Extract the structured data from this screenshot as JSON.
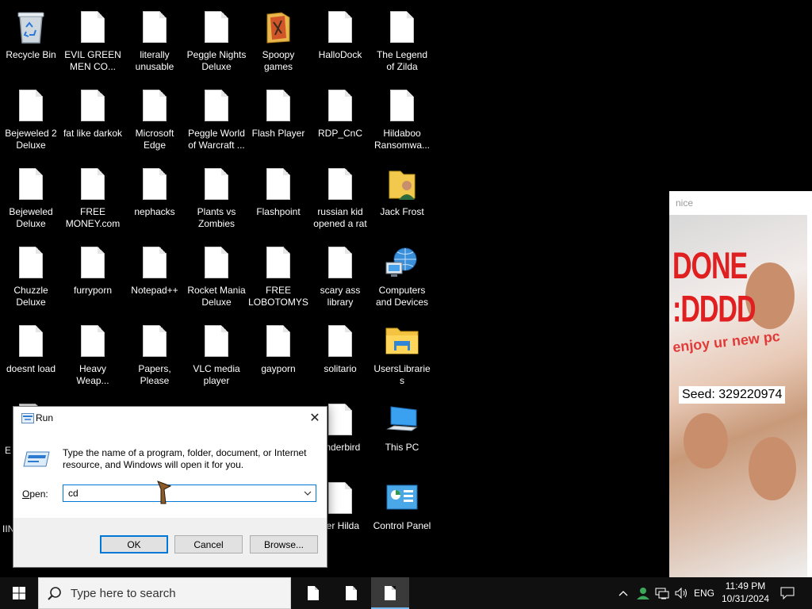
{
  "desktop_icons": [
    {
      "label": "Recycle Bin",
      "icon": "recycle-bin-icon"
    },
    {
      "label": "EVIL GREEN MEN CO...",
      "icon": "document-icon"
    },
    {
      "label": "literally unusable",
      "icon": "document-icon"
    },
    {
      "label": "Peggle Nights Deluxe",
      "icon": "document-icon"
    },
    {
      "label": "Spoopy games",
      "icon": "folder-icon"
    },
    {
      "label": "HalloDock",
      "icon": "document-icon"
    },
    {
      "label": "The Legend of Zilda",
      "icon": "document-icon"
    },
    {
      "label": "Bejeweled 2 Deluxe",
      "icon": "document-icon"
    },
    {
      "label": "fat like darkok",
      "icon": "document-icon"
    },
    {
      "label": "Microsoft Edge",
      "icon": "document-icon"
    },
    {
      "label": "Peggle World of Warcraft ...",
      "icon": "document-icon"
    },
    {
      "label": "Flash Player",
      "icon": "document-icon"
    },
    {
      "label": "RDP_CnC",
      "icon": "document-icon"
    },
    {
      "label": "Hildaboo Ransomwa...",
      "icon": "document-icon"
    },
    {
      "label": "Bejeweled Deluxe",
      "icon": "document-icon"
    },
    {
      "label": "FREE MONEY.com",
      "icon": "document-icon"
    },
    {
      "label": "nephacks",
      "icon": "document-icon"
    },
    {
      "label": "Plants vs Zombies",
      "icon": "document-icon"
    },
    {
      "label": "Flashpoint",
      "icon": "document-icon"
    },
    {
      "label": "russian kid opened a rat",
      "icon": "document-icon"
    },
    {
      "label": "Jack Frost",
      "icon": "user-folder-icon"
    },
    {
      "label": "Chuzzle Deluxe",
      "icon": "document-icon"
    },
    {
      "label": "furryporn",
      "icon": "document-icon"
    },
    {
      "label": "Notepad++",
      "icon": "document-icon"
    },
    {
      "label": "Rocket Mania Deluxe",
      "icon": "document-icon"
    },
    {
      "label": "FREE LOBOTOMYS",
      "icon": "document-icon"
    },
    {
      "label": "scary ass library",
      "icon": "document-icon"
    },
    {
      "label": "Computers and Devices",
      "icon": "network-globe-icon"
    },
    {
      "label": "doesnt load",
      "icon": "document-icon"
    },
    {
      "label": "Heavy Weap...",
      "icon": "document-icon"
    },
    {
      "label": "Papers, Please",
      "icon": "document-icon"
    },
    {
      "label": "VLC media player",
      "icon": "document-icon"
    },
    {
      "label": "gayporn",
      "icon": "document-icon"
    },
    {
      "label": "solitario",
      "icon": "document-icon"
    },
    {
      "label": "UsersLibraries",
      "icon": "libraries-folder-icon"
    },
    {
      "label": "underbird",
      "icon": "document-icon"
    },
    {
      "label": "This PC",
      "icon": "computer-icon"
    },
    {
      "label": "per Hilda",
      "icon": "document-icon"
    },
    {
      "label": "Control Panel",
      "icon": "control-panel-icon"
    },
    {
      "label": "E",
      "icon": "document-icon"
    },
    {
      "label": "IIN",
      "icon": "document-icon"
    }
  ],
  "image_viewer": {
    "title": "nice",
    "headline": "DONE :DDDD",
    "subtext": "enjoy ur new pc",
    "seed_text": "Seed: 329220974"
  },
  "run_dialog": {
    "title": "Run",
    "close_glyph": "✕",
    "description": "Type the name of a program, folder, document, or Internet resource, and Windows will open it for you.",
    "open_label_accel": "O",
    "open_label_rest": "pen:",
    "open_value": "cd",
    "ok_label": "OK",
    "cancel_label": "Cancel",
    "browse_label": "Browse..."
  },
  "taskbar": {
    "search_placeholder": "Type here to search",
    "language": "ENG",
    "time": "11:49 PM",
    "date": "10/31/2024",
    "active_app_index": 2
  },
  "colors": {
    "desktop_bg": "#000000",
    "accent": "#0078d7",
    "taskbar_bg": "#101010",
    "dialog_footer": "#f0f0f0"
  }
}
